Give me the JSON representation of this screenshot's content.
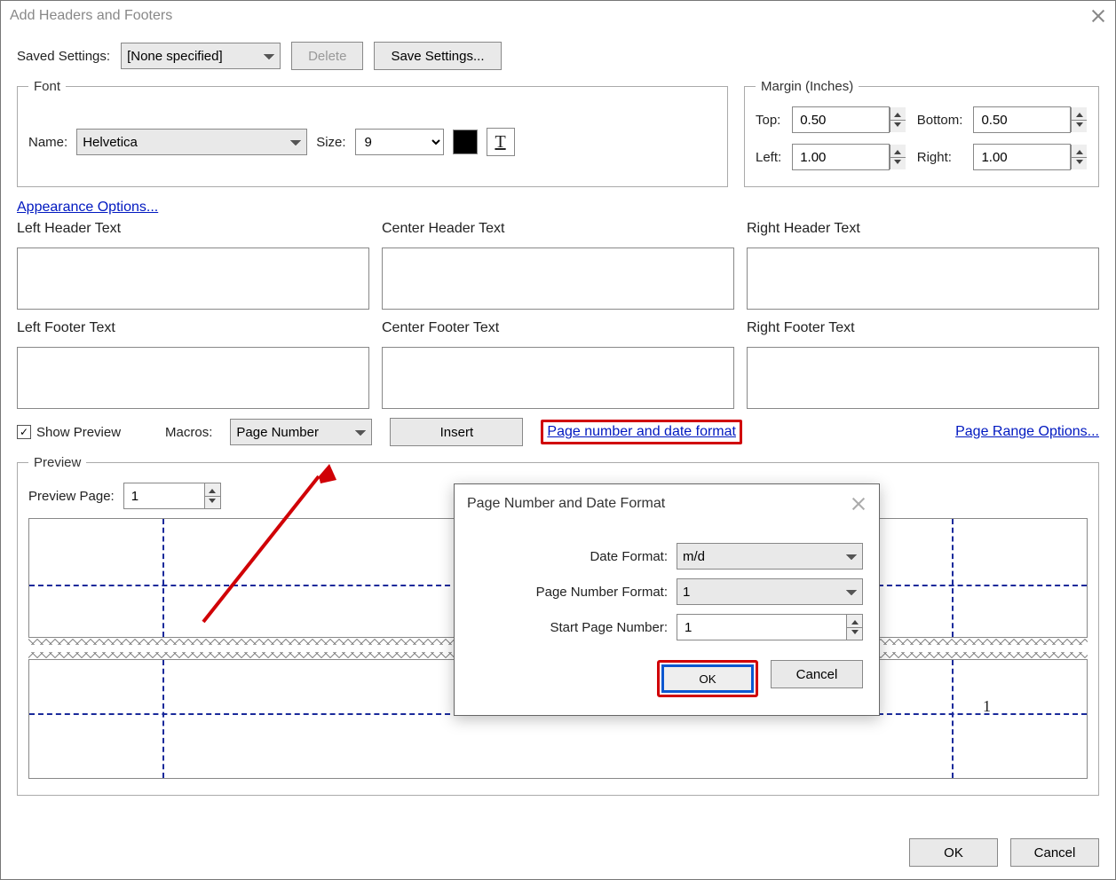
{
  "window_title": "Add Headers and Footers",
  "saved_settings": {
    "label": "Saved Settings:",
    "value": "[None specified]",
    "delete": "Delete",
    "save": "Save Settings..."
  },
  "font_group": {
    "legend": "Font",
    "name_label": "Name:",
    "name_value": "Helvetica",
    "size_label": "Size:",
    "size_value": "9",
    "underline_glyph": "T"
  },
  "margin_group": {
    "legend": "Margin (Inches)",
    "top_label": "Top:",
    "top_value": "0.50",
    "bottom_label": "Bottom:",
    "bottom_value": "0.50",
    "left_label": "Left:",
    "left_value": "1.00",
    "right_label": "Right:",
    "right_value": "1.00"
  },
  "appearance_link": "Appearance Options...",
  "fields": {
    "left_header": "Left Header Text",
    "center_header": "Center Header Text",
    "right_header": "Right Header Text",
    "left_footer": "Left Footer Text",
    "center_footer": "Center Footer Text",
    "right_footer": "Right Footer Text"
  },
  "show_preview_label": "Show Preview",
  "macros": {
    "label": "Macros:",
    "value": "Page Number",
    "insert": "Insert",
    "format_link": "Page number and date format",
    "range_link": "Page Range Options..."
  },
  "preview": {
    "legend": "Preview",
    "page_label": "Preview Page:",
    "page_value": "1",
    "page_number_shown": "1"
  },
  "buttons": {
    "ok": "OK",
    "cancel": "Cancel"
  },
  "dialog": {
    "title": "Page Number and Date Format",
    "date_label": "Date Format:",
    "date_value": "m/d",
    "pn_label": "Page Number Format:",
    "pn_value": "1",
    "start_label": "Start Page Number:",
    "start_value": "1",
    "ok": "OK",
    "cancel": "Cancel"
  }
}
